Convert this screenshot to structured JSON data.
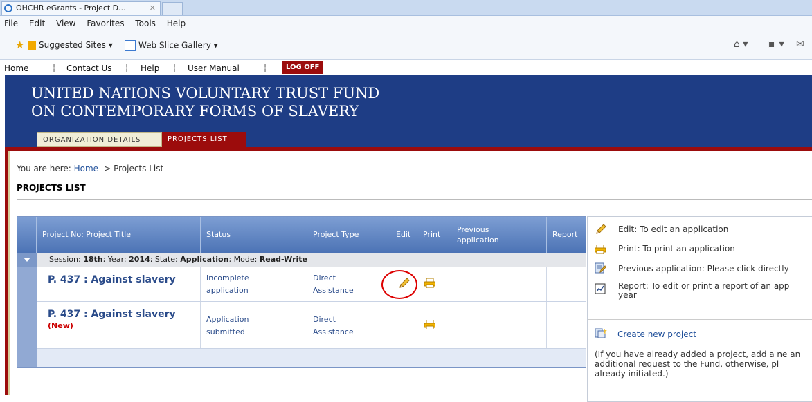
{
  "browser": {
    "tab_title": "OHCHR eGrants - Project D...",
    "tab_close": "✕",
    "menu": [
      "File",
      "Edit",
      "View",
      "Favorites",
      "Tools",
      "Help"
    ],
    "favorites": {
      "suggested_sites": "Suggested Sites ▾",
      "web_slice": "Web Slice Gallery ▾"
    }
  },
  "site_nav": {
    "items": [
      "Home",
      "Contact Us",
      "Help",
      "User Manual"
    ],
    "separator": "¦",
    "logoff": "LOG OFF"
  },
  "banner": {
    "line1": "UNITED NATIONS VOLUNTARY TRUST FUND",
    "line2": "ON CONTEMPORARY FORMS OF SLAVERY"
  },
  "section_tabs": {
    "org": "ORGANIZATION DETAILS",
    "projects": "PROJECTS LIST"
  },
  "breadcrumb": {
    "prefix": "You are here: ",
    "home": "Home",
    "rest": " -> Projects List"
  },
  "page_title": "PROJECTS LIST",
  "grid": {
    "headers": {
      "title": "Project No: Project Title",
      "status": "Status",
      "type": "Project Type",
      "edit": "Edit",
      "print": "Print",
      "previous": "Previous application",
      "report": "Report"
    },
    "session": {
      "label1": "Session: ",
      "session": "18th",
      "label2": "; Year: ",
      "year": "2014",
      "label3": "; State: ",
      "state": "Application",
      "label4": "; Mode: ",
      "mode": "Read-Write"
    },
    "rows": [
      {
        "title": "P. 437 : Against slavery",
        "tag": "",
        "status_l1": "Incomplete",
        "status_l2": "application",
        "type_l1": "Direct",
        "type_l2": "Assistance"
      },
      {
        "title": "P. 437 : Against slavery",
        "tag": "(New)",
        "status_l1": "Application",
        "status_l2": "submitted",
        "type_l1": "Direct",
        "type_l2": "Assistance"
      }
    ]
  },
  "legend": {
    "edit": "Edit: To edit an application",
    "print": "Print: To print an application",
    "previous": "Previous application: Please click directly",
    "report_l1": "Report: To edit or print a report of an app",
    "report_l2": "year",
    "create": "Create new project",
    "note": "(If you have already added a project, add a ne an additional request to the Fund, otherwise, pl already initiated.)"
  },
  "colors": {
    "banner": "#1e3d85",
    "accent_red": "#9c0c0c",
    "grid_header": "#4c73b5",
    "link": "#2a4b8a"
  }
}
